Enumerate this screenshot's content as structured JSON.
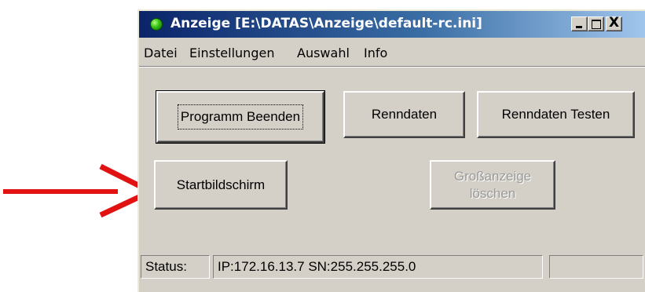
{
  "window": {
    "title": "Anzeige [E:\\DATAS\\Anzeige\\default-rc.ini]",
    "controls": {
      "minimize_icon": "minimize-icon",
      "maximize_icon": "maximize-icon",
      "close_glyph": "X"
    }
  },
  "menu": {
    "items": [
      "Datei",
      "Einstellungen",
      "Auswahl",
      "Info"
    ]
  },
  "buttons": {
    "programm_beenden": "Programm Beenden",
    "renndaten": "Renndaten",
    "renndaten_testen": "Renndaten Testen",
    "startbildschirm": "Startbildschirm",
    "grossanzeige_line1": "Großanzeige",
    "grossanzeige_line2": "löschen"
  },
  "statusbar": {
    "label": "Status:",
    "network": "IP:172.16.13.7 SN:255.255.255.0",
    "extra": ""
  },
  "colors": {
    "title_bar_start": "#0a246a",
    "title_bar_end": "#a6caf0",
    "window_face": "#d4d0c8",
    "annotation_arrow": "#e31212",
    "status_icon": "#34c016"
  },
  "icons": {
    "app_icon": "green-circle-icon",
    "annotation": "red-arrow-icon"
  }
}
